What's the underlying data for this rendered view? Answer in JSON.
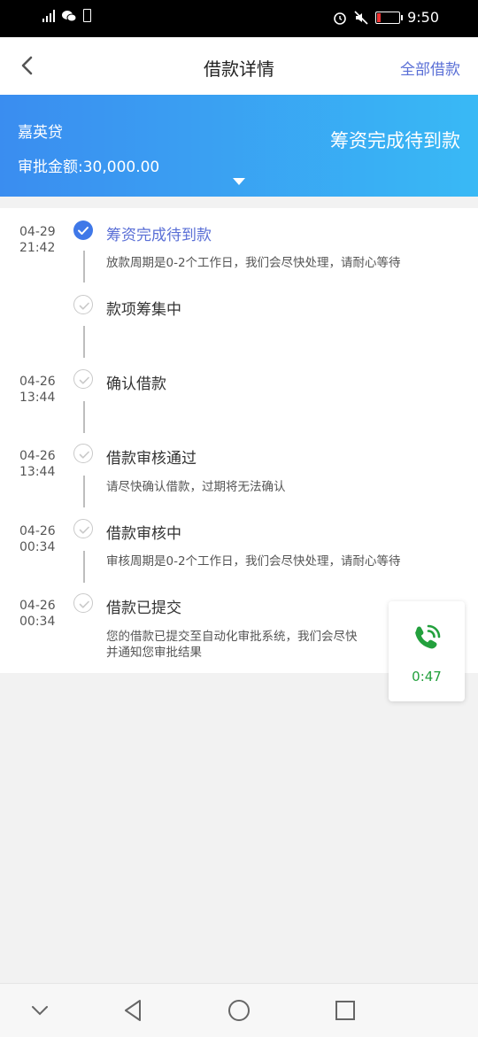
{
  "status_bar": {
    "time": "9:50"
  },
  "header": {
    "title": "借款详情",
    "right_link": "全部借款"
  },
  "banner": {
    "lender": "嘉英贷",
    "approval_label": "审批金额:30,000.00",
    "status": "筹资完成待到款"
  },
  "timeline": [
    {
      "date": "04-29",
      "time": "21:42",
      "title": "筹资完成待到款",
      "desc": "放款周期是0-2个工作日，我们会尽快处理，请耐心等待",
      "done": true
    },
    {
      "date": "",
      "time": "",
      "title": "款项筹集中",
      "desc": "",
      "done": false
    },
    {
      "date": "04-26",
      "time": "13:44",
      "title": "确认借款",
      "desc": "",
      "done": false
    },
    {
      "date": "04-26",
      "time": "13:44",
      "title": "借款审核通过",
      "desc": "请尽快确认借款，过期将无法确认",
      "done": false
    },
    {
      "date": "04-26",
      "time": "00:34",
      "title": "借款审核中",
      "desc": "审核周期是0-2个工作日，我们会尽快处理，请耐心等待",
      "done": false
    },
    {
      "date": "04-26",
      "time": "00:34",
      "title": "借款已提交",
      "desc": "您的借款已提交至自动化审批系统，我们会尽快",
      "desc2": "并通知您审批结果",
      "done": false
    }
  ],
  "call_widget": {
    "timer": "0:47"
  },
  "colors": {
    "accent": "#3f78e8",
    "link": "#5a6fd6",
    "call_green": "#23a03d"
  }
}
